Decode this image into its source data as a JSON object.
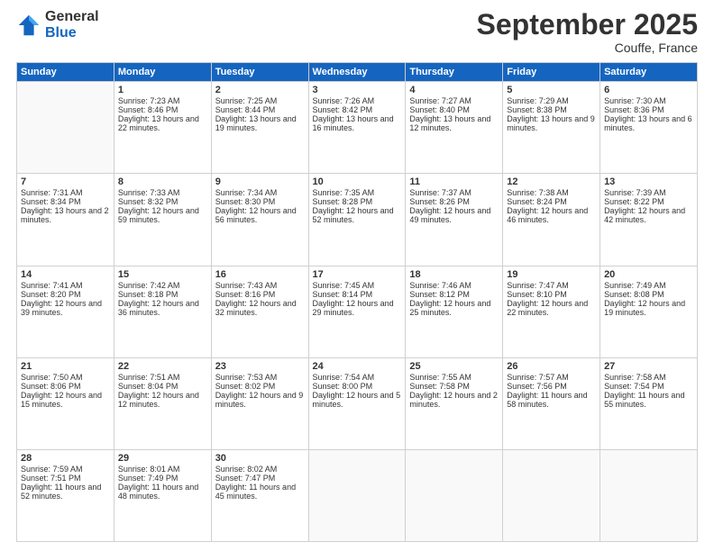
{
  "logo": {
    "general": "General",
    "blue": "Blue"
  },
  "header": {
    "month": "September 2025",
    "location": "Couffe, France"
  },
  "days_of_week": [
    "Sunday",
    "Monday",
    "Tuesday",
    "Wednesday",
    "Thursday",
    "Friday",
    "Saturday"
  ],
  "weeks": [
    [
      {
        "day": "",
        "sunrise": "",
        "sunset": "",
        "daylight": ""
      },
      {
        "day": "1",
        "sunrise": "Sunrise: 7:23 AM",
        "sunset": "Sunset: 8:46 PM",
        "daylight": "Daylight: 13 hours and 22 minutes."
      },
      {
        "day": "2",
        "sunrise": "Sunrise: 7:25 AM",
        "sunset": "Sunset: 8:44 PM",
        "daylight": "Daylight: 13 hours and 19 minutes."
      },
      {
        "day": "3",
        "sunrise": "Sunrise: 7:26 AM",
        "sunset": "Sunset: 8:42 PM",
        "daylight": "Daylight: 13 hours and 16 minutes."
      },
      {
        "day": "4",
        "sunrise": "Sunrise: 7:27 AM",
        "sunset": "Sunset: 8:40 PM",
        "daylight": "Daylight: 13 hours and 12 minutes."
      },
      {
        "day": "5",
        "sunrise": "Sunrise: 7:29 AM",
        "sunset": "Sunset: 8:38 PM",
        "daylight": "Daylight: 13 hours and 9 minutes."
      },
      {
        "day": "6",
        "sunrise": "Sunrise: 7:30 AM",
        "sunset": "Sunset: 8:36 PM",
        "daylight": "Daylight: 13 hours and 6 minutes."
      }
    ],
    [
      {
        "day": "7",
        "sunrise": "Sunrise: 7:31 AM",
        "sunset": "Sunset: 8:34 PM",
        "daylight": "Daylight: 13 hours and 2 minutes."
      },
      {
        "day": "8",
        "sunrise": "Sunrise: 7:33 AM",
        "sunset": "Sunset: 8:32 PM",
        "daylight": "Daylight: 12 hours and 59 minutes."
      },
      {
        "day": "9",
        "sunrise": "Sunrise: 7:34 AM",
        "sunset": "Sunset: 8:30 PM",
        "daylight": "Daylight: 12 hours and 56 minutes."
      },
      {
        "day": "10",
        "sunrise": "Sunrise: 7:35 AM",
        "sunset": "Sunset: 8:28 PM",
        "daylight": "Daylight: 12 hours and 52 minutes."
      },
      {
        "day": "11",
        "sunrise": "Sunrise: 7:37 AM",
        "sunset": "Sunset: 8:26 PM",
        "daylight": "Daylight: 12 hours and 49 minutes."
      },
      {
        "day": "12",
        "sunrise": "Sunrise: 7:38 AM",
        "sunset": "Sunset: 8:24 PM",
        "daylight": "Daylight: 12 hours and 46 minutes."
      },
      {
        "day": "13",
        "sunrise": "Sunrise: 7:39 AM",
        "sunset": "Sunset: 8:22 PM",
        "daylight": "Daylight: 12 hours and 42 minutes."
      }
    ],
    [
      {
        "day": "14",
        "sunrise": "Sunrise: 7:41 AM",
        "sunset": "Sunset: 8:20 PM",
        "daylight": "Daylight: 12 hours and 39 minutes."
      },
      {
        "day": "15",
        "sunrise": "Sunrise: 7:42 AM",
        "sunset": "Sunset: 8:18 PM",
        "daylight": "Daylight: 12 hours and 36 minutes."
      },
      {
        "day": "16",
        "sunrise": "Sunrise: 7:43 AM",
        "sunset": "Sunset: 8:16 PM",
        "daylight": "Daylight: 12 hours and 32 minutes."
      },
      {
        "day": "17",
        "sunrise": "Sunrise: 7:45 AM",
        "sunset": "Sunset: 8:14 PM",
        "daylight": "Daylight: 12 hours and 29 minutes."
      },
      {
        "day": "18",
        "sunrise": "Sunrise: 7:46 AM",
        "sunset": "Sunset: 8:12 PM",
        "daylight": "Daylight: 12 hours and 25 minutes."
      },
      {
        "day": "19",
        "sunrise": "Sunrise: 7:47 AM",
        "sunset": "Sunset: 8:10 PM",
        "daylight": "Daylight: 12 hours and 22 minutes."
      },
      {
        "day": "20",
        "sunrise": "Sunrise: 7:49 AM",
        "sunset": "Sunset: 8:08 PM",
        "daylight": "Daylight: 12 hours and 19 minutes."
      }
    ],
    [
      {
        "day": "21",
        "sunrise": "Sunrise: 7:50 AM",
        "sunset": "Sunset: 8:06 PM",
        "daylight": "Daylight: 12 hours and 15 minutes."
      },
      {
        "day": "22",
        "sunrise": "Sunrise: 7:51 AM",
        "sunset": "Sunset: 8:04 PM",
        "daylight": "Daylight: 12 hours and 12 minutes."
      },
      {
        "day": "23",
        "sunrise": "Sunrise: 7:53 AM",
        "sunset": "Sunset: 8:02 PM",
        "daylight": "Daylight: 12 hours and 9 minutes."
      },
      {
        "day": "24",
        "sunrise": "Sunrise: 7:54 AM",
        "sunset": "Sunset: 8:00 PM",
        "daylight": "Daylight: 12 hours and 5 minutes."
      },
      {
        "day": "25",
        "sunrise": "Sunrise: 7:55 AM",
        "sunset": "Sunset: 7:58 PM",
        "daylight": "Daylight: 12 hours and 2 minutes."
      },
      {
        "day": "26",
        "sunrise": "Sunrise: 7:57 AM",
        "sunset": "Sunset: 7:56 PM",
        "daylight": "Daylight: 11 hours and 58 minutes."
      },
      {
        "day": "27",
        "sunrise": "Sunrise: 7:58 AM",
        "sunset": "Sunset: 7:54 PM",
        "daylight": "Daylight: 11 hours and 55 minutes."
      }
    ],
    [
      {
        "day": "28",
        "sunrise": "Sunrise: 7:59 AM",
        "sunset": "Sunset: 7:51 PM",
        "daylight": "Daylight: 11 hours and 52 minutes."
      },
      {
        "day": "29",
        "sunrise": "Sunrise: 8:01 AM",
        "sunset": "Sunset: 7:49 PM",
        "daylight": "Daylight: 11 hours and 48 minutes."
      },
      {
        "day": "30",
        "sunrise": "Sunrise: 8:02 AM",
        "sunset": "Sunset: 7:47 PM",
        "daylight": "Daylight: 11 hours and 45 minutes."
      },
      {
        "day": "",
        "sunrise": "",
        "sunset": "",
        "daylight": ""
      },
      {
        "day": "",
        "sunrise": "",
        "sunset": "",
        "daylight": ""
      },
      {
        "day": "",
        "sunrise": "",
        "sunset": "",
        "daylight": ""
      },
      {
        "day": "",
        "sunrise": "",
        "sunset": "",
        "daylight": ""
      }
    ]
  ]
}
